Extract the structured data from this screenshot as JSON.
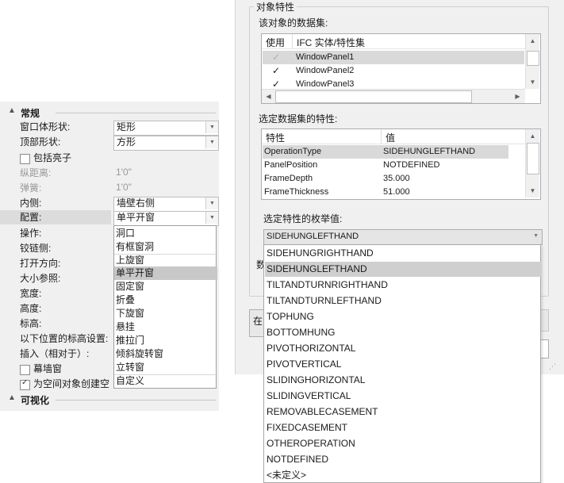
{
  "left_panel": {
    "sections": {
      "general": "常规",
      "visibility": "可视化"
    },
    "props": {
      "window_shape": {
        "label": "窗口体形状:",
        "value": "矩形"
      },
      "top_shape": {
        "label": "顶部形状:",
        "value": "方形"
      },
      "include_mullion": {
        "label": "包括亮子",
        "checked": false
      },
      "depth": {
        "label": "纵距离:",
        "value": "1'0\""
      },
      "spring": {
        "label": "弹簧:",
        "value": "1'0\""
      },
      "inside": {
        "label": "内侧:",
        "value": "墙壁右侧"
      },
      "config": {
        "label": "配置:",
        "value": "单平开窗"
      },
      "operation": {
        "label": "操作:"
      },
      "hinge_side": {
        "label": "铰链侧:"
      },
      "open_direction": {
        "label": "打开方向:"
      },
      "size_ref": {
        "label": "大小参照:"
      },
      "width": {
        "label": "宽度:"
      },
      "height": {
        "label": "高度:"
      },
      "elevation": {
        "label": "标高:"
      },
      "elev_setting": {
        "label": "以下位置的标高设置:"
      },
      "insert": {
        "label": "插入（相对于）:"
      },
      "curtain_wall": {
        "label": "幕墙窗",
        "checked": false
      },
      "create_space": {
        "label": "为空间对象创建空",
        "checked": true
      }
    },
    "config_dropdown": {
      "items": [
        "洞口",
        "有框窗洞",
        "上旋窗",
        "单平开窗",
        "固定窗",
        "折叠",
        "下旋窗",
        "悬挂",
        "推拉门",
        "倾斜旋转窗",
        "立转窗",
        "自定义"
      ],
      "selected": "单平开窗"
    }
  },
  "dialog": {
    "group_title": "对象特性",
    "datasets_label": "该对象的数据集:",
    "datasets_columns": {
      "use": "使用",
      "entity": "IFC 实体/特性集"
    },
    "datasets_rows": [
      {
        "name": "WindowPanel1",
        "checked": true,
        "selected": true
      },
      {
        "name": "WindowPanel2",
        "checked": true,
        "selected": false
      },
      {
        "name": "WindowPanel3",
        "checked": true,
        "selected": false
      }
    ],
    "props_label": "选定数据集的特性:",
    "props_columns": {
      "property": "特性",
      "value": "值"
    },
    "props_rows": [
      {
        "name": "OperationType",
        "value": "SIDEHUNGLEFTHAND",
        "selected": true
      },
      {
        "name": "PanelPosition",
        "value": "NOTDEFINED",
        "selected": false
      },
      {
        "name": "FrameDepth",
        "value": "35.000",
        "selected": false
      },
      {
        "name": "FrameThickness",
        "value": "51.000",
        "selected": false
      }
    ],
    "enum_label": "选定特性的枚举值:",
    "enum_value": "SIDEHUNGLEFTHAND",
    "enum_options": [
      "SIDEHUNGRIGHTHAND",
      "SIDEHUNGLEFTHAND",
      "TILTANDTURNRIGHTHAND",
      "TILTANDTURNLEFTHAND",
      "TOPHUNG",
      "BOTTOMHUNG",
      "PIVOTHORIZONTAL",
      "PIVOTVERTICAL",
      "SLIDINGHORIZONTAL",
      "SLIDINGVERTICAL",
      "REMOVABLECASEMENT",
      "FIXEDCASEMENT",
      "OTHEROPERATION",
      "NOTDEFINED",
      "<未定义>"
    ],
    "enum_selected": "SIDEHUNGLEFTHAND",
    "partial_label_char": "数",
    "partial_button_char": "在"
  }
}
